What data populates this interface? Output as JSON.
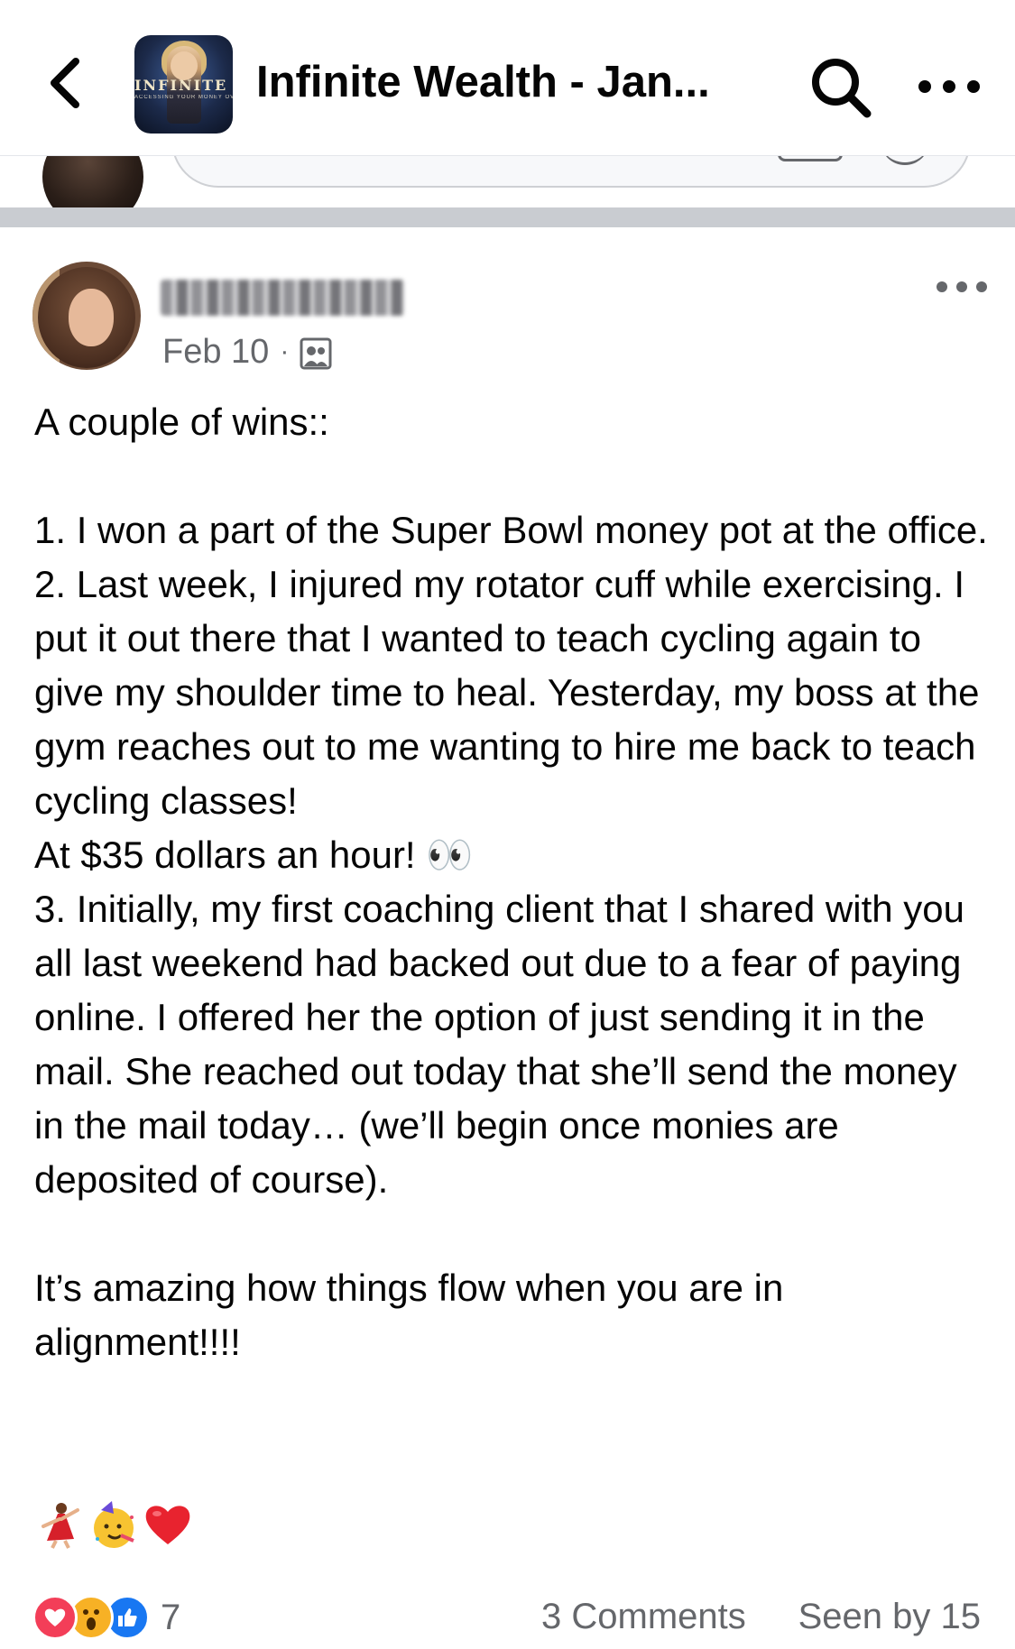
{
  "header": {
    "title": "Infinite Wealth - Jan...",
    "thumbnail_word": "INFINITE WEALTH",
    "thumbnail_tagline": "ACCESSING YOUR MONEY OVERFLOW",
    "icons": {
      "back": "chevron-left-icon",
      "search": "search-icon",
      "more": "more-horizontal-icon"
    }
  },
  "post": {
    "author_name": "",
    "date": "Feb 10",
    "separator": "·",
    "audience_icon": "group-members-icon",
    "paragraphs": [
      "A couple of wins::",
      "1. I won a part of the Super Bowl money pot at the office.\n2. Last week, I injured my rotator cuff while exercising. I put it out there that I wanted to teach cycling again to give my shoulder time to heal. Yesterday, my boss at the gym reaches out to me wanting to hire me back to teach cycling classes!\nAt $35 dollars an hour!",
      "3. Initially, my first coaching client that I shared with you all last weekend had backed out due to a fear of paying online. I offered her the option of just sending it in the mail. She reached out today that she’ll send the money in the mail today… (we’ll begin once monies are deposited of course).",
      "It’s amazing how things flow when you are in alignment!!!!"
    ],
    "eyes_emoji": "👀",
    "closing_emojis": [
      "dancer-icon",
      "party-face-icon",
      "red-heart-icon"
    ]
  },
  "footer": {
    "reactions": [
      "love-reaction-icon",
      "wow-reaction-icon",
      "like-reaction-icon"
    ],
    "reaction_count": "7",
    "comments": "3 Comments",
    "seen_by": "Seen by 15"
  },
  "colors": {
    "text": "#050505",
    "secondary_text": "#65676b",
    "divider": "#c9ccd1",
    "like_blue": "#1877f2",
    "love_red": "#f33e58",
    "wow_yellow": "#f7b125"
  }
}
